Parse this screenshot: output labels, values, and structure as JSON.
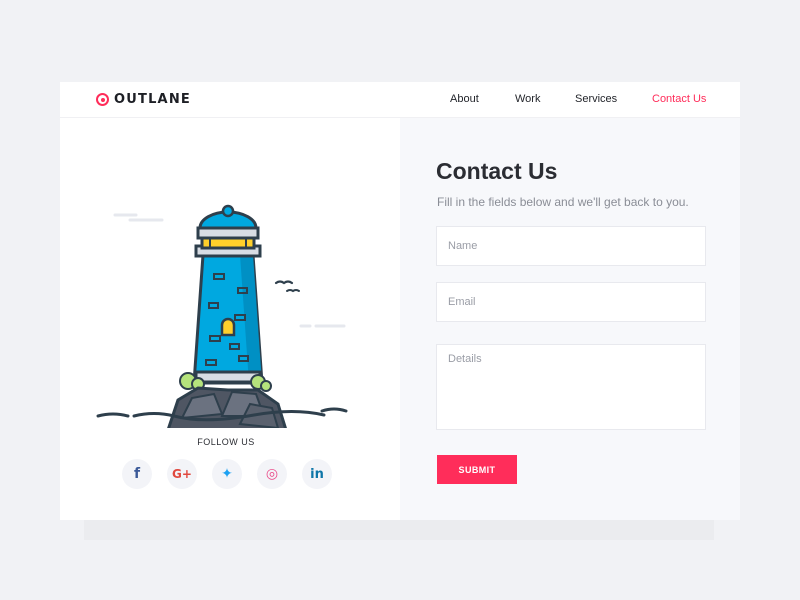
{
  "brand": {
    "name": "OUTLANE"
  },
  "nav": {
    "items": [
      "About",
      "Work",
      "Services",
      "Contact Us"
    ],
    "active_index": 3
  },
  "colors": {
    "accent": "#ff2d5a",
    "sea": "#00a8e0",
    "rock": "#4f5663",
    "outline": "#2e3f4c"
  },
  "contact": {
    "title": "Contact Us",
    "description": "Fill in the fields below and we'll get back to you.",
    "name_placeholder": "Name",
    "email_placeholder": "Email",
    "details_placeholder": "Details",
    "submit_label": "SUBMIT"
  },
  "social": {
    "heading": "FOLLOW US",
    "buttons": [
      {
        "glyph": "f",
        "icon": "facebook-icon",
        "color": "#3b5998"
      },
      {
        "glyph": "G+",
        "icon": "google-plus-icon",
        "color": "#e0483e"
      },
      {
        "glyph": "✦",
        "icon": "twitter-icon",
        "color": "#1da1f2"
      },
      {
        "glyph": "◎",
        "icon": "dribbble-icon",
        "color": "#ea4c89"
      },
      {
        "glyph": "in",
        "icon": "linkedin-icon",
        "color": "#0e76a8"
      }
    ]
  }
}
